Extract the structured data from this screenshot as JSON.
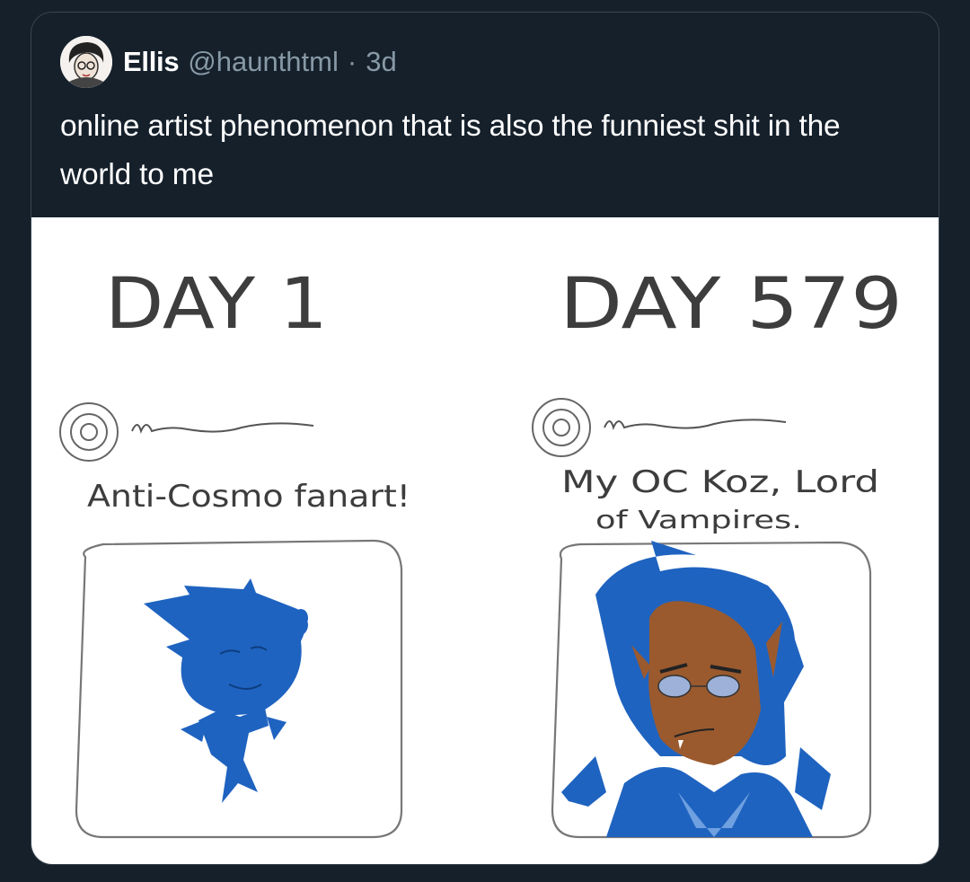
{
  "tweet": {
    "author": {
      "display_name": "Ellis",
      "handle": "@haunthtml",
      "avatar_icon": "avatar-icon"
    },
    "separator": "·",
    "timestamp": "3d",
    "text": "online artist phenomenon that is also the funniest shit in the world to me"
  },
  "media": {
    "panels": [
      {
        "day_label": "DAY 1",
        "caption": "Anti-Cosmo fanart!"
      },
      {
        "day_label": "DAY 579",
        "caption_line1": "My OC Koz, Lord",
        "caption_line2": "of Vampires."
      }
    ],
    "colors": {
      "background": "#15202b",
      "border": "#38444d",
      "text": "#ffffff",
      "muted": "#8899a6",
      "drawing_blue": "#1f63c0",
      "skin": "#9a5a2e"
    }
  }
}
